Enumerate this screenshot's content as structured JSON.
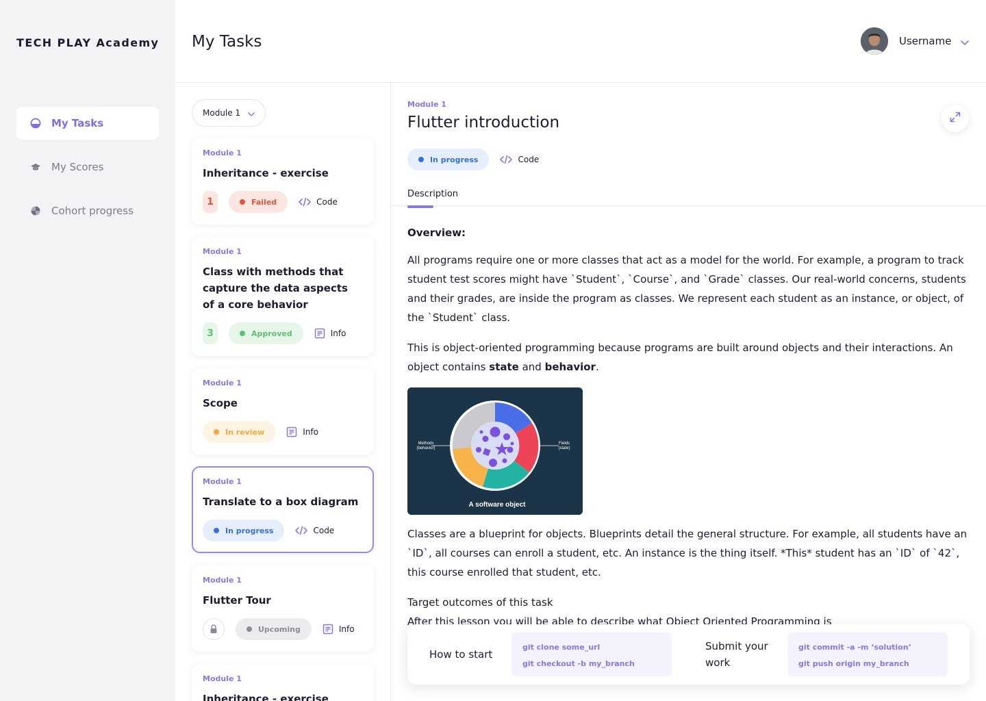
{
  "app": {
    "logo": "TECH PLAY Academy"
  },
  "sidebar": {
    "items": [
      {
        "label": "My Tasks",
        "icon": "tasks-icon",
        "active": true
      },
      {
        "label": "My Scores",
        "icon": "graduation-cap-icon",
        "active": false
      },
      {
        "label": "Cohort progress",
        "icon": "pie-chart-icon",
        "active": false
      }
    ]
  },
  "header": {
    "title": "My Tasks",
    "username": "Username"
  },
  "task_list": {
    "module_select": "Module 1",
    "cards": [
      {
        "module": "Module 1",
        "title": "Inheritance - exercise",
        "count": "1",
        "status": "Failed",
        "link": "Code"
      },
      {
        "module": "Module 1",
        "title": "Class with methods that capture the data aspects of a core behavior",
        "count": "3",
        "status": "Approved",
        "link": "Info"
      },
      {
        "module": "Module 1",
        "title": "Scope",
        "status": "In review",
        "link": "Info"
      },
      {
        "module": "Module 1",
        "title": "Translate to a box diagram",
        "status": "In progress",
        "link": "Code"
      },
      {
        "module": "Module 1",
        "title": "Flutter Tour",
        "status": "Upcoming",
        "link": "Info"
      },
      {
        "module": "Module 1",
        "title": "Inheritance - exercise"
      }
    ]
  },
  "detail": {
    "module": "Module 1",
    "title": "Flutter introduction",
    "status": "In progress",
    "link": "Code",
    "tab": "Description",
    "overview_heading": "Overview:",
    "p1": "All programs require one or more classes that act as a model for the world. For example, a program to track student test scores might have `Student`, `Course`, and `Grade` classes. Our real-world concerns, students and their grades, are inside the program as classes. We represent each student as an instance, or object, of the `Student` class.",
    "p2_start": "This is object-oriented programming because programs are built around objects and their interactions. An object contains ",
    "p2_state": "state",
    "p2_and": " and ",
    "p2_behavior": "behavior",
    "p2_end": ".",
    "figure": {
      "left_label_1": "Methods",
      "left_label_2": "(behavior)",
      "right_label_1": "Fields",
      "right_label_2": "(state)",
      "caption": "A software object"
    },
    "p3": "Classes are a blueprint for objects. Blueprints detail the general structure. For example, all students have an `ID`, all courses can enroll a student, etc. An instance is the thing itself. *This* student has an `ID` of `42`, this course enrolled that student, etc.",
    "target_heading": "Target outcomes of this task",
    "target_text": "After this lesson you will be able to describe what Object Oriented Programming is"
  },
  "bottom_panel": {
    "start_label": "How to start",
    "start_cmds": [
      "git clone some_url",
      "git checkout -b my_branch"
    ],
    "submit_label_1": "Submit your",
    "submit_label_2": "work",
    "submit_cmds": [
      "git commit -a -m ‘solution’",
      "git push origin my_branch"
    ]
  },
  "colors": {
    "accent": "#8a78e0",
    "failed": "#e0553b",
    "approved": "#5fbf72",
    "review": "#f0a940",
    "progress": "#3a6fd8"
  }
}
